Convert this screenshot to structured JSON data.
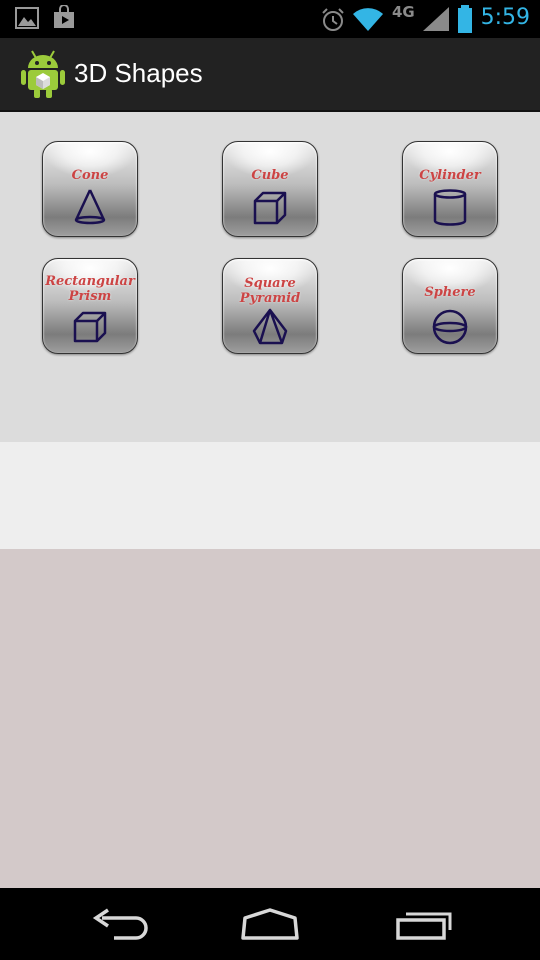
{
  "status_bar": {
    "time": "5:59",
    "network_label": "4G",
    "icons": [
      "gallery-icon",
      "store-icon",
      "alarm-icon",
      "wifi-icon",
      "signal-icon",
      "battery-icon"
    ],
    "clock_color": "#33b5e5"
  },
  "action_bar": {
    "title": "3D Shapes",
    "icon": "android-app-icon"
  },
  "shapes": [
    {
      "label": "Cone",
      "icon": "cone-icon"
    },
    {
      "label": "Cube",
      "icon": "cube-icon"
    },
    {
      "label": "Cylinder",
      "icon": "cylinder-icon"
    },
    {
      "label_line1": "Rectangular",
      "label_line2": "Prism",
      "icon": "rectangular-prism-icon"
    },
    {
      "label_line1": "Square",
      "label_line2": "Pyramid",
      "icon": "square-pyramid-icon"
    },
    {
      "label": "Sphere",
      "icon": "sphere-icon"
    }
  ],
  "nav_bar": {
    "buttons": [
      "back-icon",
      "home-icon",
      "recent-apps-icon"
    ]
  },
  "colors": {
    "label_red": "#cc4444",
    "shape_stroke": "#1a1050",
    "content_bg": "#dcdcdc",
    "strip_bg": "#eeeeee",
    "lower_bg": "#d3c9c9"
  }
}
